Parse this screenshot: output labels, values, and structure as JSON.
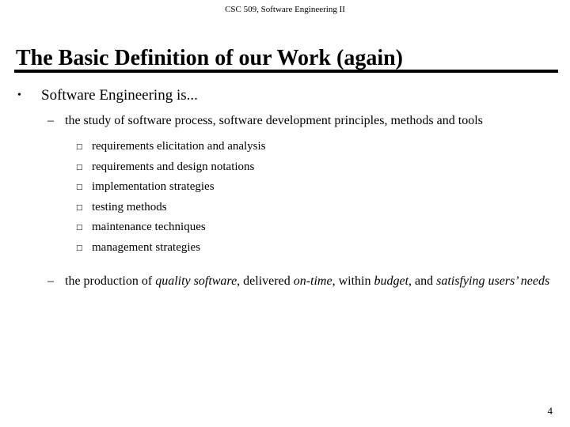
{
  "slide": {
    "header": "CSC 509, Software Engineering II",
    "title": "The Basic Definition of our Work (again)",
    "page_number": "4",
    "bullet_glyphs": {
      "level1": "•",
      "level2": "–",
      "level3": "□"
    },
    "colors": {
      "background": "#ffffff",
      "text": "#000000",
      "rule": "#000000"
    },
    "content": {
      "level1_item": "Software Engineering is...",
      "level2_item_1": "the study of software process, software development principles, methods and tools",
      "level3_items": [
        "requirements elicitation and analysis",
        "requirements and design notations",
        "implementation strategies",
        "testing methods",
        "maintenance techniques",
        "management strategies"
      ],
      "level2_item_2": {
        "part1": "the production of ",
        "em1": "quality software",
        "part2": ", delivered ",
        "em2": "on-time",
        "part3": ", within ",
        "em3": "budget",
        "part4": ", and ",
        "em4": "satisfying users’ needs"
      }
    }
  }
}
